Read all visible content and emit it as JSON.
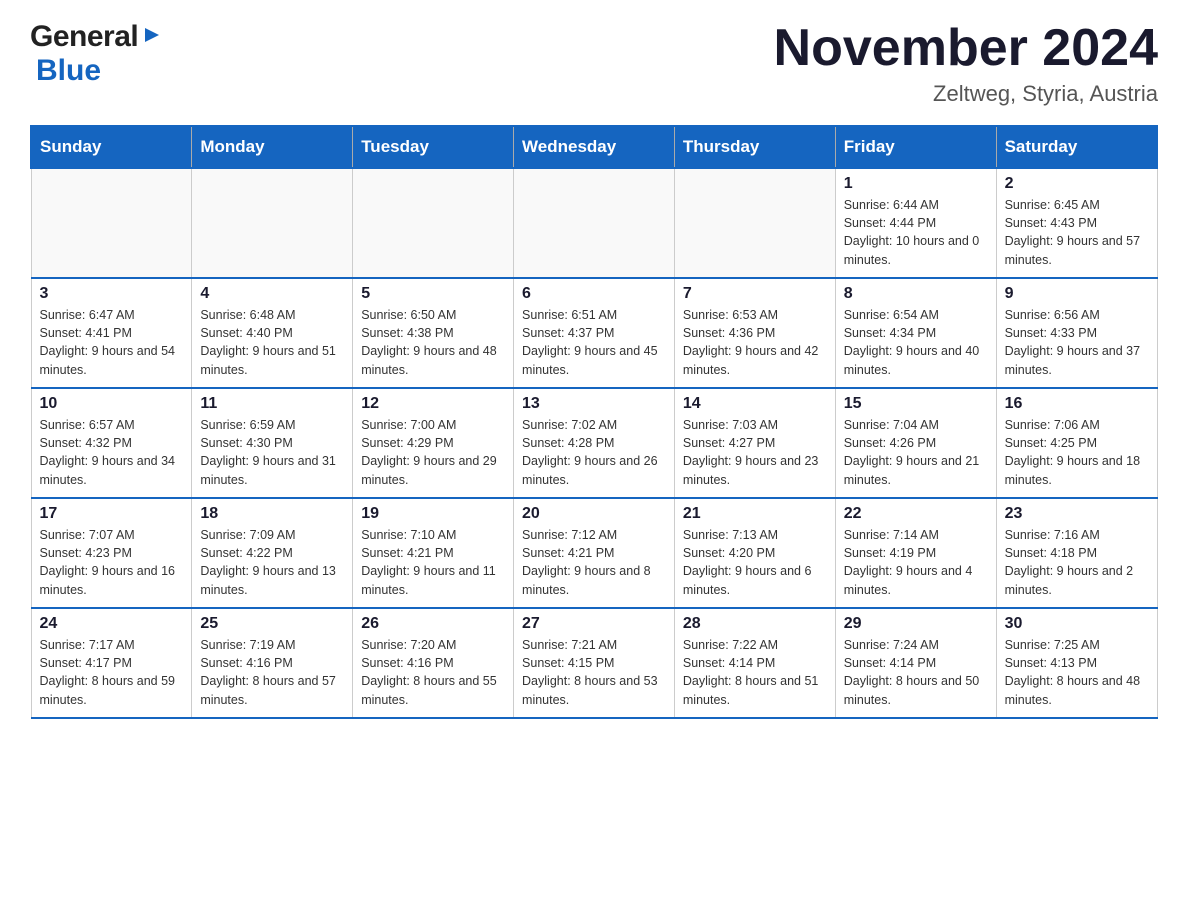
{
  "header": {
    "logo": {
      "general": "General",
      "blue": "Blue",
      "arrow": "▶"
    },
    "title": "November 2024",
    "location": "Zeltweg, Styria, Austria"
  },
  "weekdays": [
    "Sunday",
    "Monday",
    "Tuesday",
    "Wednesday",
    "Thursday",
    "Friday",
    "Saturday"
  ],
  "weeks": [
    [
      {
        "day": "",
        "info": ""
      },
      {
        "day": "",
        "info": ""
      },
      {
        "day": "",
        "info": ""
      },
      {
        "day": "",
        "info": ""
      },
      {
        "day": "",
        "info": ""
      },
      {
        "day": "1",
        "info": "Sunrise: 6:44 AM\nSunset: 4:44 PM\nDaylight: 10 hours and 0 minutes."
      },
      {
        "day": "2",
        "info": "Sunrise: 6:45 AM\nSunset: 4:43 PM\nDaylight: 9 hours and 57 minutes."
      }
    ],
    [
      {
        "day": "3",
        "info": "Sunrise: 6:47 AM\nSunset: 4:41 PM\nDaylight: 9 hours and 54 minutes."
      },
      {
        "day": "4",
        "info": "Sunrise: 6:48 AM\nSunset: 4:40 PM\nDaylight: 9 hours and 51 minutes."
      },
      {
        "day": "5",
        "info": "Sunrise: 6:50 AM\nSunset: 4:38 PM\nDaylight: 9 hours and 48 minutes."
      },
      {
        "day": "6",
        "info": "Sunrise: 6:51 AM\nSunset: 4:37 PM\nDaylight: 9 hours and 45 minutes."
      },
      {
        "day": "7",
        "info": "Sunrise: 6:53 AM\nSunset: 4:36 PM\nDaylight: 9 hours and 42 minutes."
      },
      {
        "day": "8",
        "info": "Sunrise: 6:54 AM\nSunset: 4:34 PM\nDaylight: 9 hours and 40 minutes."
      },
      {
        "day": "9",
        "info": "Sunrise: 6:56 AM\nSunset: 4:33 PM\nDaylight: 9 hours and 37 minutes."
      }
    ],
    [
      {
        "day": "10",
        "info": "Sunrise: 6:57 AM\nSunset: 4:32 PM\nDaylight: 9 hours and 34 minutes."
      },
      {
        "day": "11",
        "info": "Sunrise: 6:59 AM\nSunset: 4:30 PM\nDaylight: 9 hours and 31 minutes."
      },
      {
        "day": "12",
        "info": "Sunrise: 7:00 AM\nSunset: 4:29 PM\nDaylight: 9 hours and 29 minutes."
      },
      {
        "day": "13",
        "info": "Sunrise: 7:02 AM\nSunset: 4:28 PM\nDaylight: 9 hours and 26 minutes."
      },
      {
        "day": "14",
        "info": "Sunrise: 7:03 AM\nSunset: 4:27 PM\nDaylight: 9 hours and 23 minutes."
      },
      {
        "day": "15",
        "info": "Sunrise: 7:04 AM\nSunset: 4:26 PM\nDaylight: 9 hours and 21 minutes."
      },
      {
        "day": "16",
        "info": "Sunrise: 7:06 AM\nSunset: 4:25 PM\nDaylight: 9 hours and 18 minutes."
      }
    ],
    [
      {
        "day": "17",
        "info": "Sunrise: 7:07 AM\nSunset: 4:23 PM\nDaylight: 9 hours and 16 minutes."
      },
      {
        "day": "18",
        "info": "Sunrise: 7:09 AM\nSunset: 4:22 PM\nDaylight: 9 hours and 13 minutes."
      },
      {
        "day": "19",
        "info": "Sunrise: 7:10 AM\nSunset: 4:21 PM\nDaylight: 9 hours and 11 minutes."
      },
      {
        "day": "20",
        "info": "Sunrise: 7:12 AM\nSunset: 4:21 PM\nDaylight: 9 hours and 8 minutes."
      },
      {
        "day": "21",
        "info": "Sunrise: 7:13 AM\nSunset: 4:20 PM\nDaylight: 9 hours and 6 minutes."
      },
      {
        "day": "22",
        "info": "Sunrise: 7:14 AM\nSunset: 4:19 PM\nDaylight: 9 hours and 4 minutes."
      },
      {
        "day": "23",
        "info": "Sunrise: 7:16 AM\nSunset: 4:18 PM\nDaylight: 9 hours and 2 minutes."
      }
    ],
    [
      {
        "day": "24",
        "info": "Sunrise: 7:17 AM\nSunset: 4:17 PM\nDaylight: 8 hours and 59 minutes."
      },
      {
        "day": "25",
        "info": "Sunrise: 7:19 AM\nSunset: 4:16 PM\nDaylight: 8 hours and 57 minutes."
      },
      {
        "day": "26",
        "info": "Sunrise: 7:20 AM\nSunset: 4:16 PM\nDaylight: 8 hours and 55 minutes."
      },
      {
        "day": "27",
        "info": "Sunrise: 7:21 AM\nSunset: 4:15 PM\nDaylight: 8 hours and 53 minutes."
      },
      {
        "day": "28",
        "info": "Sunrise: 7:22 AM\nSunset: 4:14 PM\nDaylight: 8 hours and 51 minutes."
      },
      {
        "day": "29",
        "info": "Sunrise: 7:24 AM\nSunset: 4:14 PM\nDaylight: 8 hours and 50 minutes."
      },
      {
        "day": "30",
        "info": "Sunrise: 7:25 AM\nSunset: 4:13 PM\nDaylight: 8 hours and 48 minutes."
      }
    ]
  ]
}
